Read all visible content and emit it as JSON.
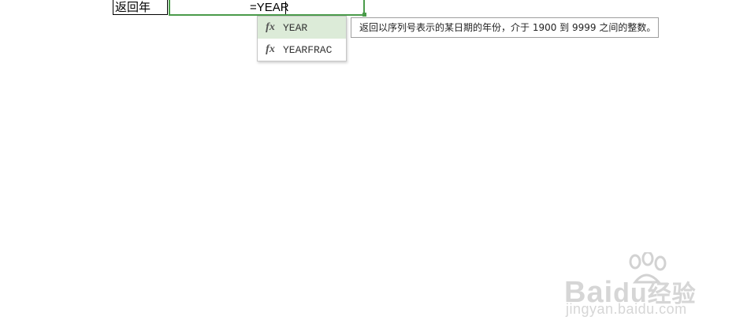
{
  "sheet": {
    "label_cell": "返回年",
    "formula_input": "=YEAR"
  },
  "autocomplete": {
    "items": [
      {
        "icon": "fx",
        "label": "YEAR",
        "selected": true
      },
      {
        "icon": "fx",
        "label": "YEARFRAC",
        "selected": false
      }
    ]
  },
  "tooltip": {
    "text": "返回以序列号表示的某日期的年份，介于 1900 到 9999 之间的整数。"
  },
  "watermark": {
    "logo_text": "Bai",
    "logo_text_cn": "经验",
    "url": "jingyan.baidu.com"
  },
  "colors": {
    "active_cell_border": "#4a9b4a",
    "selected_item_bg": "#dcebd8"
  }
}
